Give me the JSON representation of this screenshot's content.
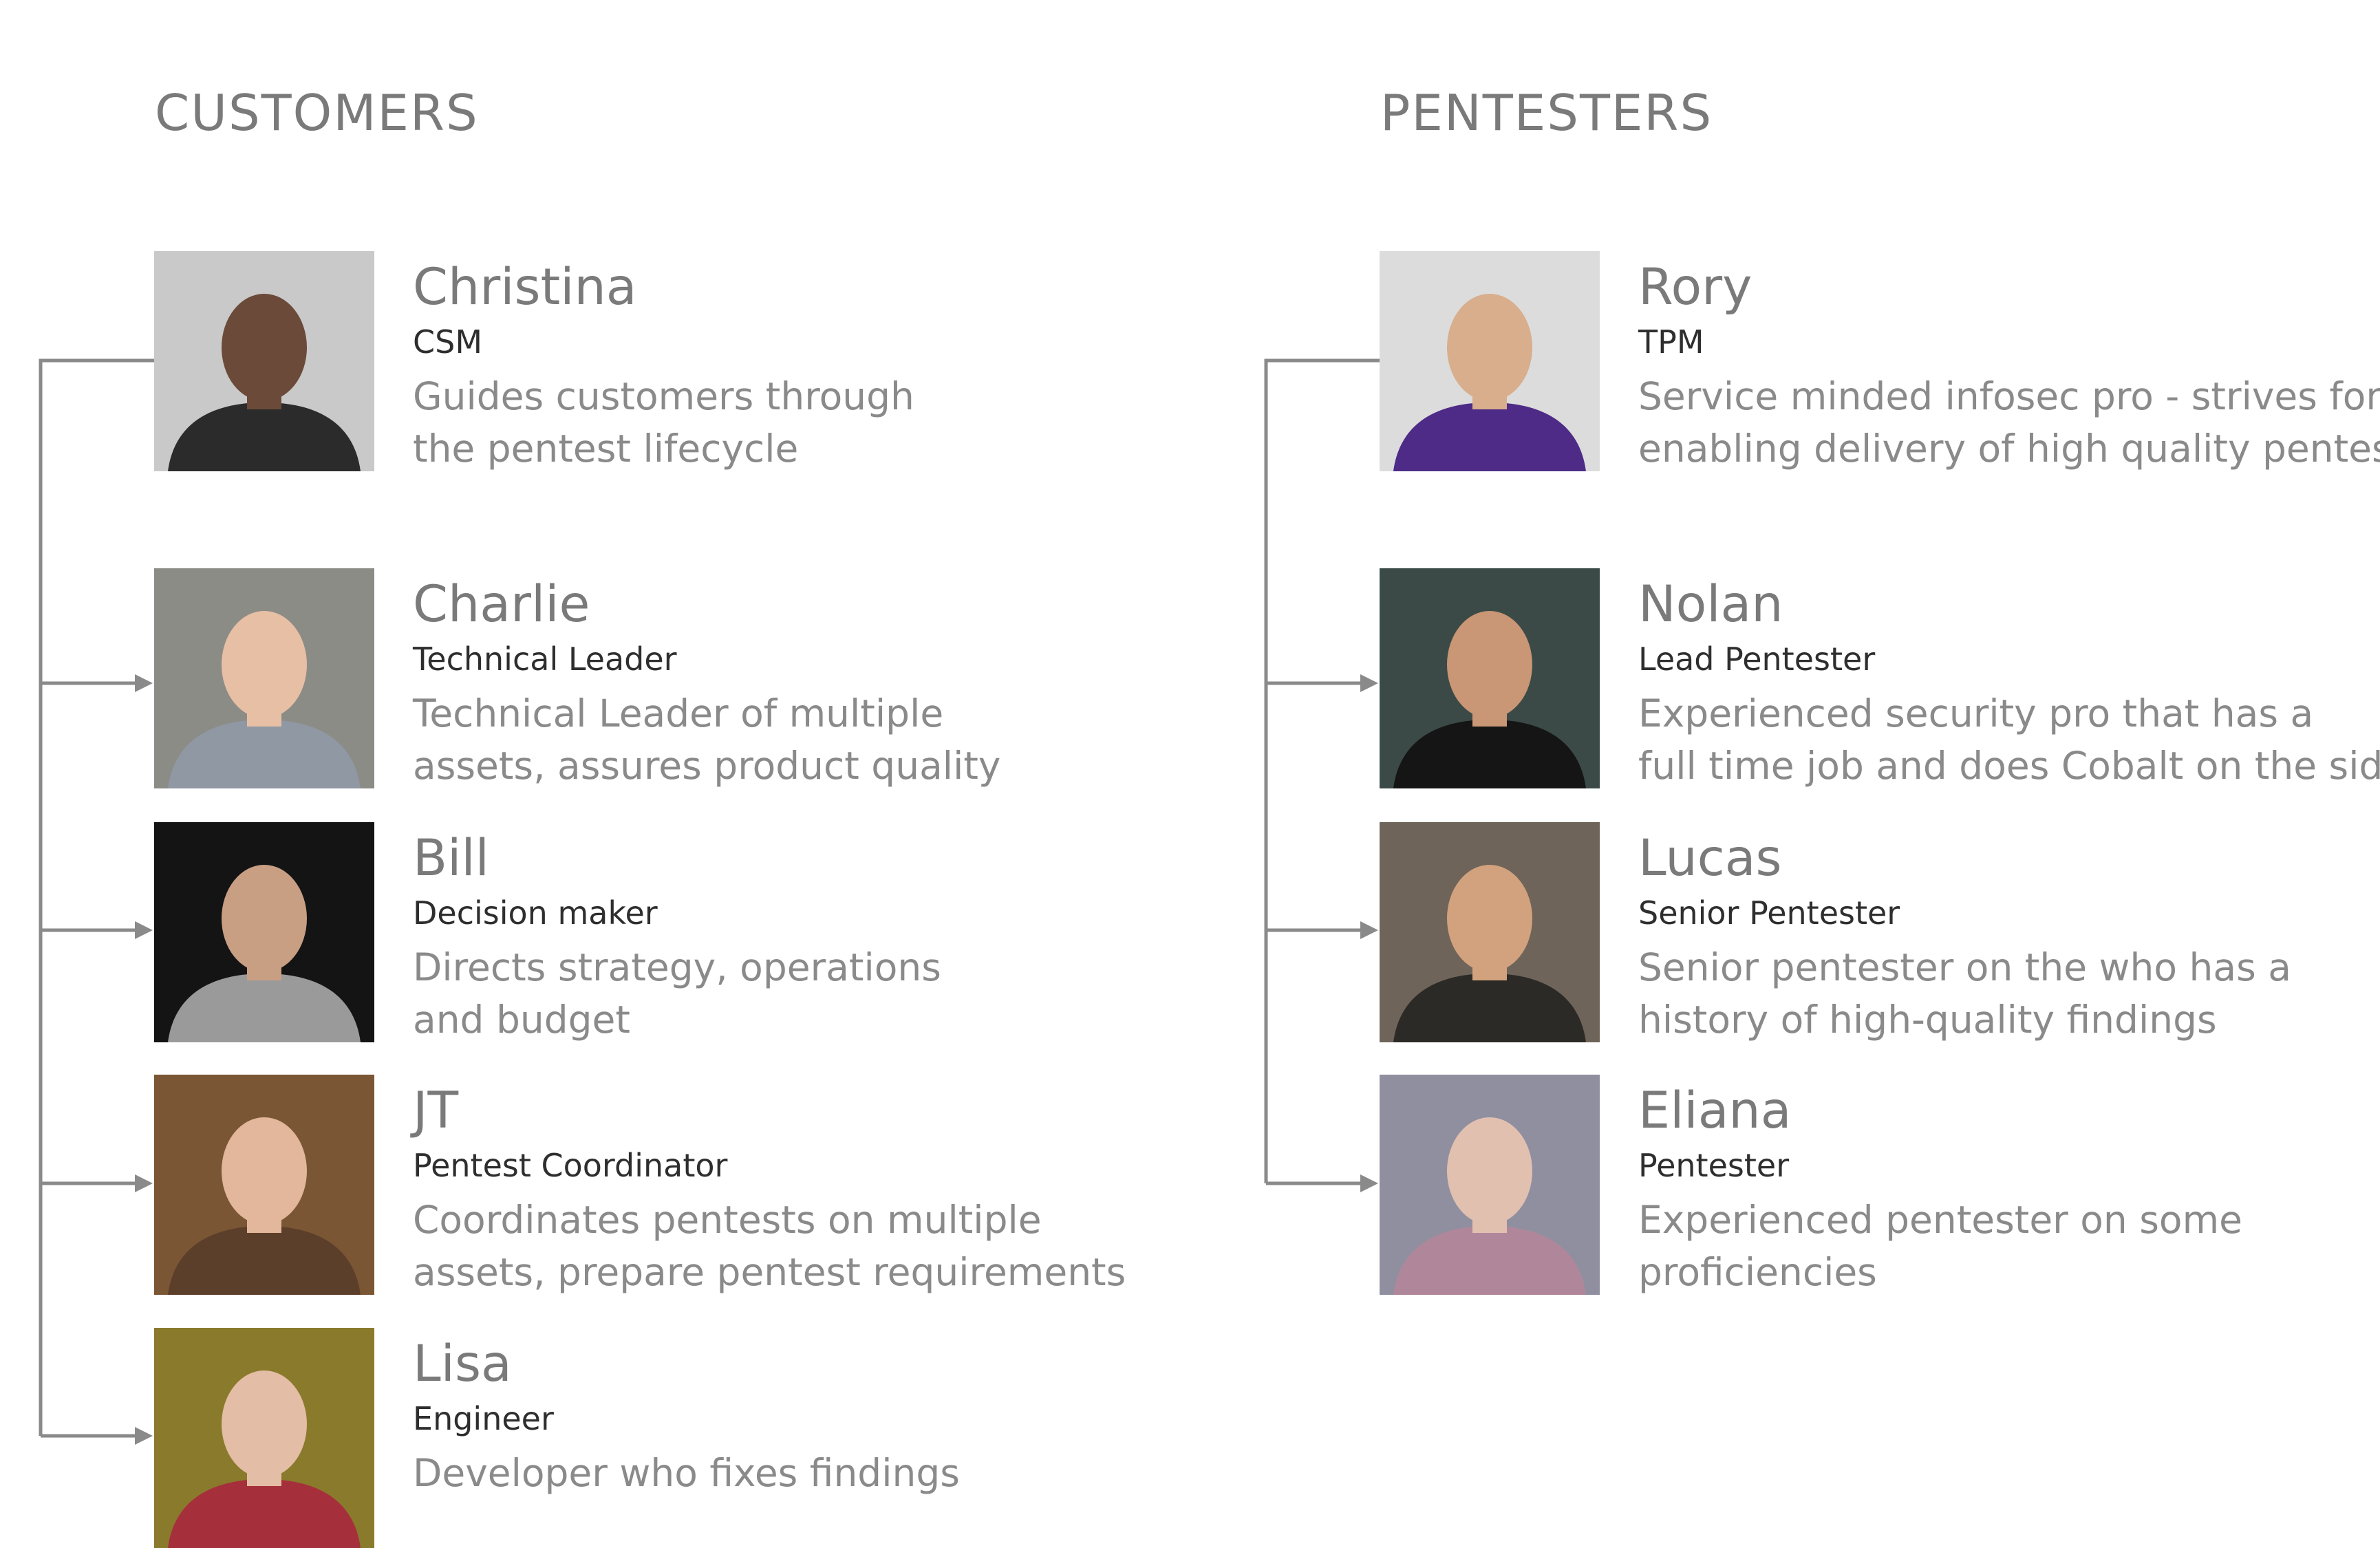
{
  "headings": {
    "customers": "CUSTOMERS",
    "pentesters": "PENTESTERS"
  },
  "customers": [
    {
      "name": "Christina",
      "role": "CSM",
      "desc1": "Guides customers through",
      "desc2": "the pentest lifecycle",
      "photo_bg": "#c9c9c9",
      "photo_fg": "#6b4a39",
      "photo_shirt": "#2b2b2b"
    },
    {
      "name": "Charlie",
      "role": "Technical Leader",
      "desc1": "Technical Leader of multiple",
      "desc2": "assets, assures product quality",
      "photo_bg": "#8c8c86",
      "photo_fg": "#e7bfa5",
      "photo_shirt": "#8f98a3"
    },
    {
      "name": "Bill",
      "role": "Decision maker",
      "desc1": "Directs strategy, operations",
      "desc2": "and budget",
      "photo_bg": "#141414",
      "photo_fg": "#c99f84",
      "photo_shirt": "#9a9a9a"
    },
    {
      "name": "JT",
      "role": "Pentest Coordinator",
      "desc1": "Coordinates pentests on multiple",
      "desc2": "assets, prepare pentest requirements",
      "photo_bg": "#7a5634",
      "photo_fg": "#e2b79b",
      "photo_shirt": "#5c3f2a"
    },
    {
      "name": "Lisa",
      "role": "Engineer",
      "desc1": "Developer who fixes findings",
      "desc2": "",
      "photo_bg": "#8a7a2c",
      "photo_fg": "#e3bda5",
      "photo_shirt": "#a62f3c"
    }
  ],
  "pentesters": [
    {
      "name": "Rory",
      "role": "TPM",
      "desc1": "Service minded infosec pro - strives for",
      "desc2": "enabling delivery of high quality pentests",
      "photo_bg": "#dcdcdc",
      "photo_fg": "#d8ae8c",
      "photo_shirt": "#4d2b86"
    },
    {
      "name": "Nolan",
      "role": "Lead Pentester",
      "desc1": "Experienced security pro that has a",
      "desc2": "full time job and does Cobalt on the side.",
      "photo_bg": "#3b4a46",
      "photo_fg": "#c99676",
      "photo_shirt": "#151515"
    },
    {
      "name": "Lucas",
      "role": "Senior Pentester",
      "desc1": "Senior pentester on the who has a",
      "desc2": "history of high-quality findings",
      "photo_bg": "#6f6459",
      "photo_fg": "#d2a27e",
      "photo_shirt": "#2c2a27"
    },
    {
      "name": "Eliana",
      "role": "Pentester",
      "desc1": "Experienced pentester on some",
      "desc2": "proficiencies",
      "photo_bg": "#8f8fa0",
      "photo_fg": "#e2c0b0",
      "photo_shirt": "#b0879a"
    }
  ],
  "colors": {
    "heading": "#7a7a7a",
    "name": "#7a7a7a",
    "role": "#2e2e2e",
    "description": "#8a8a8a",
    "connector": "#8a8a8a"
  }
}
